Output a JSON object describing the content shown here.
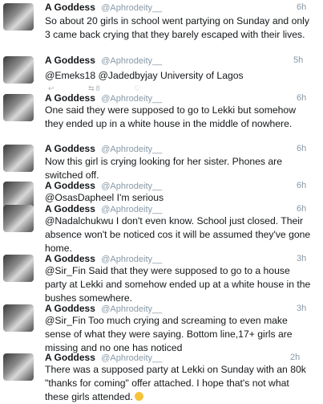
{
  "tweets": [
    {
      "name": "A Goddess",
      "handle": "@Aphrodeity__",
      "time": "6h",
      "text": "So about 20 girls in school went partying on Sunday and only 3 came back crying that they barely escaped with their lives."
    },
    {
      "name": "A Goddess",
      "handle": "@Aphrodeity__",
      "time": "5h",
      "text": "@Emeks18 @Jadedbyjay University of Lagos"
    },
    {
      "retweet_count": "8"
    },
    {
      "name": "A Goddess",
      "handle": "@Aphrodeity__",
      "time": "6h",
      "text": "One said they were supposed to go to Lekki but somehow they ended up in a white house in the middle of nowhere."
    },
    {
      "name": "A Goddess",
      "handle": "@Aphrodeity__",
      "time": "6h",
      "text": "Now this girl is crying looking for her sister. Phones are switched off."
    },
    {
      "name": "A Goddess",
      "handle": "@Aphrodeity__",
      "time": "6h",
      "text": "@OsasDapheel I'm serious"
    },
    {
      "name": "A Goddess",
      "handle": "@Aphrodeity__",
      "time": "6h",
      "text": "@Nadalchukwu I don't even know. School just closed. Their absence won't be noticed cos it will be assumed they've gone home."
    },
    {
      "name": "A Goddess",
      "handle": "@Aphrodeity__",
      "time": "3h",
      "text": "@Sir_Fin Said that they were supposed to go to a house party at Lekki and somehow ended up at a white house in the bushes somewhere."
    },
    {
      "name": "A Goddess",
      "handle": "@Aphrodeity__",
      "time": "3h",
      "text": "@Sir_Fin Too much crying and screaming to even make sense of what they were saying. Bottom line,17+ girls are missing and no one has noticed"
    },
    {
      "name": "A Goddess",
      "handle": "@Aphrodeity__",
      "time": "2h",
      "text": "There was a supposed party at Lekki on Sunday with an 80k \"thanks for coming\" offer attached. I hope that's not what these girls attended."
    }
  ],
  "icons": {
    "reply": "reply-icon",
    "retweet": "retweet-icon",
    "like": "heart-icon",
    "emoji": "sad-face-emoji"
  }
}
